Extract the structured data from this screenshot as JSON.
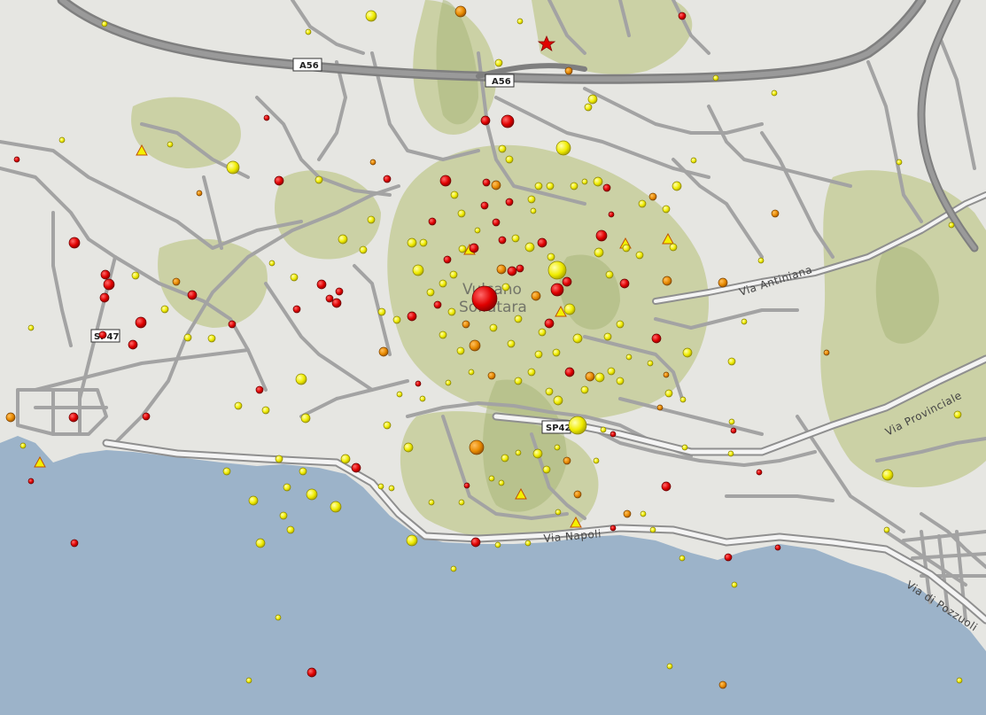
{
  "place_label": {
    "line1": "Vulcano",
    "line2": "Solfatara"
  },
  "road_labels": {
    "via_antiniana": "Via Antiniana",
    "via_provinciale": "Via Provinciale",
    "via_napoli": "Via Napoli",
    "via_di_pozzuoli": "Via di Pozzuoli"
  },
  "shields": {
    "a56_west": "A56",
    "a56_east": "A56",
    "sp47": "SP47",
    "sp42": "SP42"
  },
  "colors": {
    "sea": "#9cb3c9",
    "land": "#e6e6e2",
    "relief": "#c5cc9a",
    "road": "#a3a3a3",
    "highway": "#7f7f7f",
    "event_red": "#e00000",
    "event_orange": "#e88a00",
    "event_yellow": "#f4f000"
  },
  "legend_symbols": {
    "star": "star-icon",
    "triangle": "triangle-icon"
  }
}
